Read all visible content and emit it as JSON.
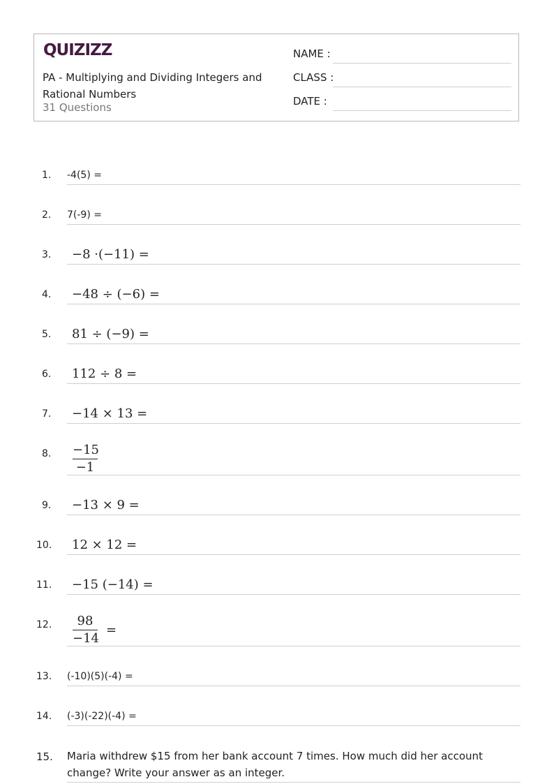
{
  "header": {
    "logo": "QUIZIZZ",
    "title": "PA - Multiplying and Dividing Integers and Rational Numbers",
    "question_count": "31 Questions",
    "fields": [
      {
        "label": "NAME :"
      },
      {
        "label": "CLASS :"
      },
      {
        "label": "DATE  :"
      }
    ]
  },
  "questions": [
    {
      "number": "1.",
      "text": "-4(5) ="
    },
    {
      "number": "2.",
      "text": "7(-9) ="
    },
    {
      "number": "3.",
      "text": "−8  ·(−11) ="
    },
    {
      "number": "4.",
      "text": "−48  ÷  (−6)  ="
    },
    {
      "number": "5.",
      "text": "81  ÷ (−9)  ="
    },
    {
      "number": "6.",
      "text": "112  ÷  8  ="
    },
    {
      "number": "7.",
      "text": "−14  ×  13  ="
    },
    {
      "number": "8.",
      "numerator": "−15",
      "denominator": "−1",
      "suffix": ""
    },
    {
      "number": "9.",
      "text": "−13  ×  9  ="
    },
    {
      "number": "10.",
      "text": "12  ×  12  ="
    },
    {
      "number": "11.",
      "text": "−15 (−14)  ="
    },
    {
      "number": "12.",
      "numerator": "98",
      "denominator": "−14",
      "suffix": "="
    },
    {
      "number": "13.",
      "text": "(-10)(5)(-4) ="
    },
    {
      "number": "14.",
      "text": "(-3)(-22)(-4) ="
    },
    {
      "number": "15.",
      "text": "Maria withdrew $15 from her bank account 7 times. How much did her account change? Write your answer as an integer."
    }
  ]
}
